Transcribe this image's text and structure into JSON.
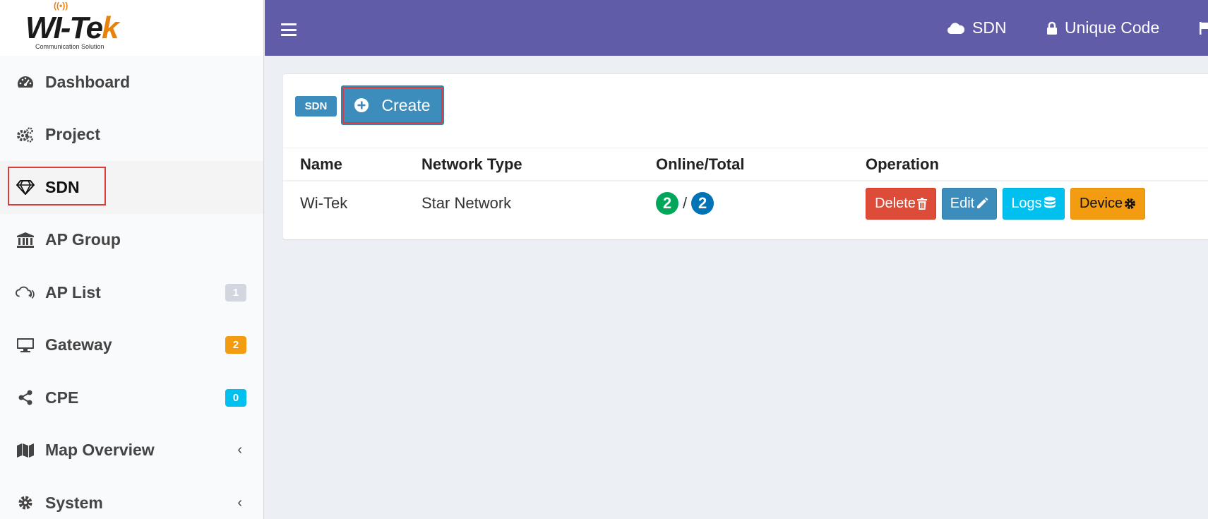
{
  "logo": {
    "text_main": "WI-Te",
    "text_k": "k",
    "subtitle": "Communication Solution"
  },
  "sidebar": {
    "items": [
      {
        "label": "Dashboard",
        "icon": "dashboard-icon"
      },
      {
        "label": "Project",
        "icon": "gears-icon"
      },
      {
        "label": "SDN",
        "icon": "diamond-icon",
        "active": true
      },
      {
        "label": "AP Group",
        "icon": "bank-icon"
      },
      {
        "label": "AP List",
        "icon": "cloud-wifi-icon",
        "badge": "1",
        "badge_color": "#d2d6de"
      },
      {
        "label": "Gateway",
        "icon": "desktop-icon",
        "badge": "2",
        "badge_color": "#f39c12"
      },
      {
        "label": "CPE",
        "icon": "share-icon",
        "badge": "0",
        "badge_color": "#00c0ef"
      },
      {
        "label": "Map Overview",
        "icon": "map-icon",
        "chevron": "‹"
      },
      {
        "label": "System",
        "icon": "gear-icon",
        "chevron": "‹"
      }
    ]
  },
  "header": {
    "background": "#605ca8",
    "nav": [
      {
        "label": "SDN",
        "icon": "cloud-icon"
      },
      {
        "label": "Unique Code",
        "icon": "lock-icon"
      }
    ]
  },
  "content": {
    "section_label": "SDN",
    "create_label": "Create",
    "table": {
      "columns": [
        "Name",
        "Network Type",
        "Online/Total",
        "Operation"
      ],
      "rows": [
        {
          "name": "Wi-Tek",
          "network_type": "Star Network",
          "online": "2",
          "separator": "/",
          "total": "2",
          "actions": [
            "Delete",
            "Edit",
            "Logs",
            "Device"
          ]
        }
      ]
    }
  },
  "colors": {
    "accent": "#3c8dbc",
    "danger": "#dd4b39",
    "info": "#00c0ef",
    "warning": "#f39c12",
    "success": "#00a65a",
    "highlight": "#dd3b3b"
  }
}
